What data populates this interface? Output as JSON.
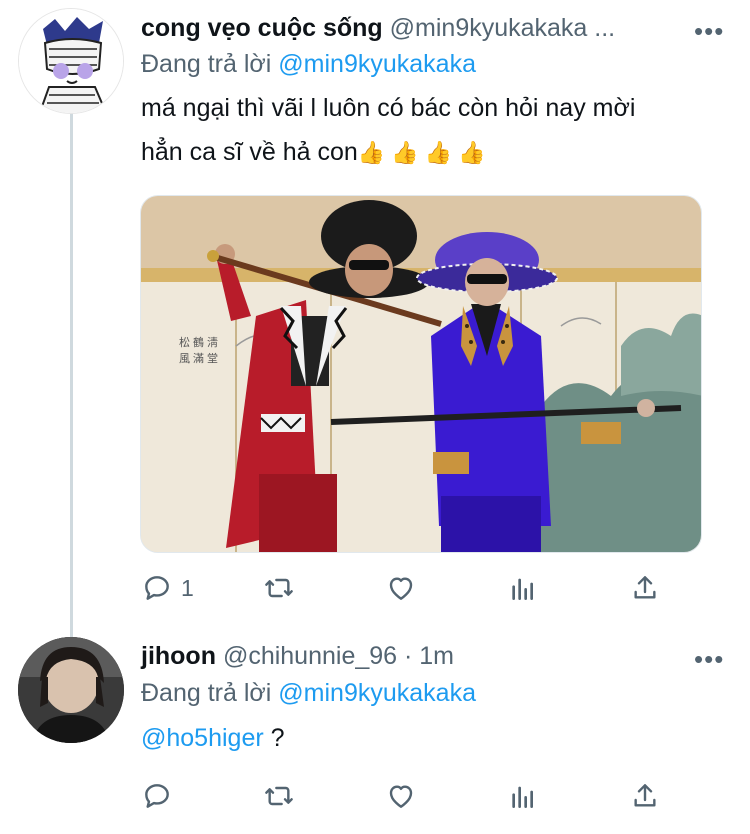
{
  "tweets": [
    {
      "display_name": "cong vẹo cuộc sống",
      "handle": "@min9kyukakaka ...",
      "more": "•••",
      "replying_prefix": "Đang trả lời",
      "replying_to": "@min9kyukakaka",
      "text_line1": "má ngại thì vãi l luôn có bác còn hỏi nay mời",
      "text_line2": "hẳn ca sĩ về hả con",
      "emojis": "👍 👍 👍 👍",
      "reply_count": "1",
      "icons": [
        "reply-icon",
        "retweet-icon",
        "like-icon",
        "analytics-icon",
        "share-icon"
      ]
    },
    {
      "display_name": "jihoon",
      "handle": "@chihunnie_96 · 1m",
      "more": "•••",
      "replying_prefix": "Đang trả lời",
      "replying_to": "@min9kyukakaka",
      "text_mention": "@ho5higer",
      "text_rest": " ?",
      "icons": [
        "reply-icon",
        "retweet-icon",
        "like-icon",
        "analytics-icon",
        "share-icon"
      ]
    }
  ],
  "colors": {
    "link": "#1d9bf0",
    "secondary": "#536471",
    "thread_line": "#cfd9de"
  }
}
